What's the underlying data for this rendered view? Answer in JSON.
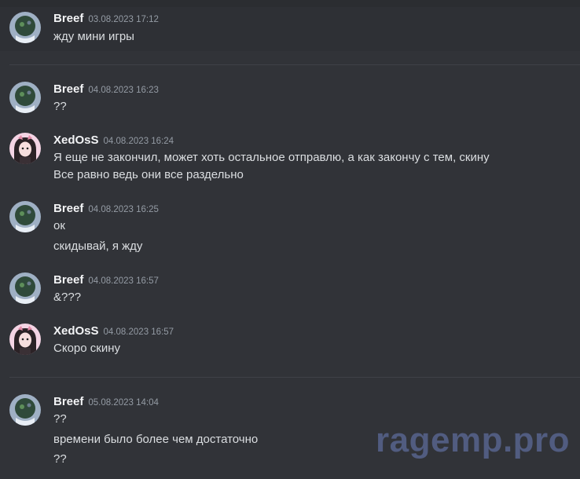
{
  "messages": [
    {
      "author": "Breef",
      "timestamp": "03.08.2023 17:12",
      "lines": [
        "жду мини игры"
      ]
    },
    {
      "author": "Breef",
      "timestamp": "04.08.2023 16:23",
      "lines": [
        "??"
      ]
    },
    {
      "author": "XedOsS",
      "timestamp": "04.08.2023 16:24",
      "lines": [
        "Я еще не закончил, может хоть остальное отправлю, а как закончу с тем, скину",
        "Все равно ведь они все раздельно"
      ]
    },
    {
      "author": "Breef",
      "timestamp": "04.08.2023 16:25",
      "lines": [
        "ок",
        "скидывай, я жду"
      ]
    },
    {
      "author": "Breef",
      "timestamp": "04.08.2023 16:57",
      "lines": [
        "&???"
      ]
    },
    {
      "author": "XedOsS",
      "timestamp": "04.08.2023 16:57",
      "lines": [
        "Скоро скину"
      ]
    },
    {
      "author": "Breef",
      "timestamp": "05.08.2023 14:04",
      "lines": [
        "??",
        "времени было более чем достаточно",
        "??"
      ]
    }
  ],
  "watermark": "ragemp.pro",
  "colors": {
    "background": "#313338",
    "author": "#f2f3f5",
    "timestamp": "#949ba4",
    "text": "#dbdee1"
  }
}
